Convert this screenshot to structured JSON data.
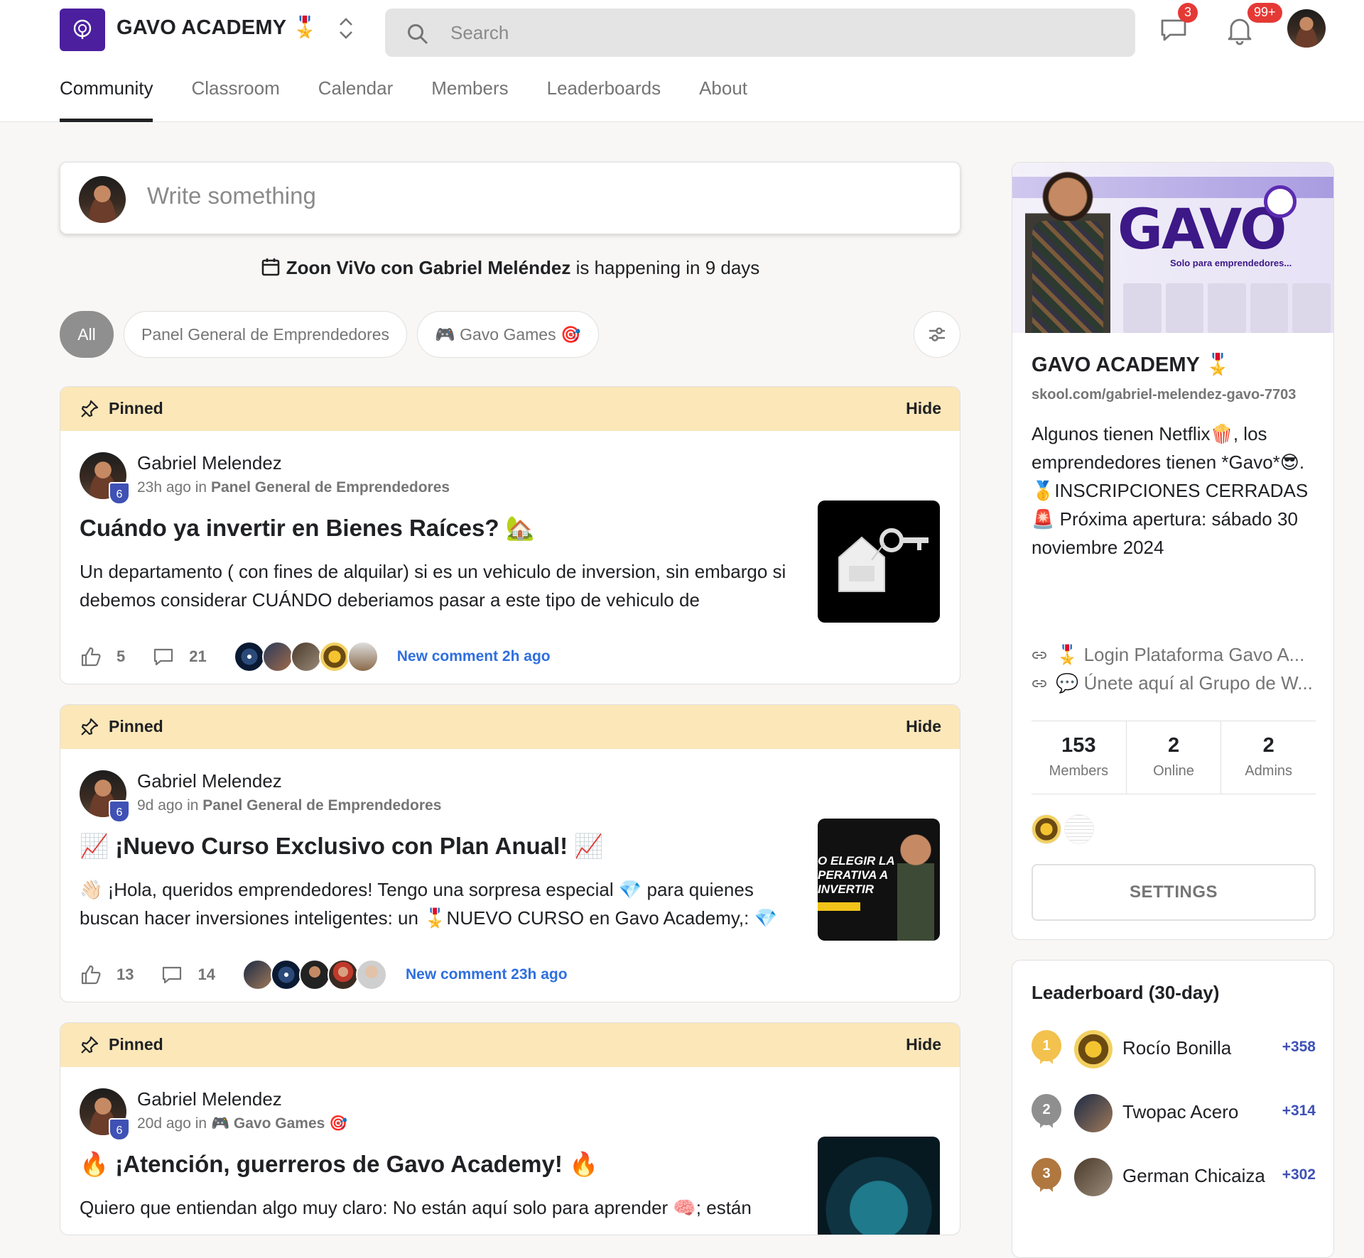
{
  "header": {
    "brand": "GAVO ACADEMY 🎖️",
    "search_placeholder": "Search",
    "chat_badge": "3",
    "notif_badge": "99+",
    "tabs": [
      {
        "label": "Community"
      },
      {
        "label": "Classroom"
      },
      {
        "label": "Calendar"
      },
      {
        "label": "Members"
      },
      {
        "label": "Leaderboards"
      },
      {
        "label": "About"
      }
    ]
  },
  "composer": {
    "placeholder": "Write something"
  },
  "event": {
    "title": "Zoon ViVo con Gabriel Meléndez",
    "suffix": " is happening in 9 days"
  },
  "filters": [
    {
      "label": "All"
    },
    {
      "label": "Panel General de Emprendedores"
    },
    {
      "label": "🎮 Gavo Games 🎯"
    }
  ],
  "posts": [
    {
      "pinned": "Pinned",
      "hide": "Hide",
      "author": "Gabriel Melendez",
      "level": "6",
      "time": "23h ago in ",
      "category": "Panel General de Emprendedores",
      "title": "Cuándo ya invertir en Bienes Raíces? 🏡",
      "body": "Un departamento ( con fines de alquilar) si es un vehiculo de inversion, sin embargo si debemos considerar CUÁNDO deberiamos pasar a este tipo de vehiculo de",
      "likes": "5",
      "comments": "21",
      "new_comment": "New comment 2h ago"
    },
    {
      "pinned": "Pinned",
      "hide": "Hide",
      "author": "Gabriel Melendez",
      "level": "6",
      "time": "9d ago in ",
      "category": "Panel General de Emprendedores",
      "title": "📈 ¡Nuevo Curso Exclusivo con Plan Anual! 📈",
      "body": "👋🏻 ¡Hola, queridos emprendedores! Tengo una sorpresa especial 💎 para quienes buscan hacer inversiones inteligentes: un 🎖️NUEVO CURSO en Gavo Academy,: 💎",
      "likes": "13",
      "comments": "14",
      "new_comment": "New comment 23h ago",
      "thumb_text": "O ELEGIR LA PERATIVA A INVERTIR"
    },
    {
      "pinned": "Pinned",
      "hide": "Hide",
      "author": "Gabriel Melendez",
      "level": "6",
      "time": "20d ago in ",
      "category": "🎮 Gavo Games 🎯",
      "title": "🔥 ¡Atención, guerreros de Gavo Academy! 🔥",
      "body": "Quiero que entiendan algo muy claro: No están aquí solo para aprender 🧠; están"
    }
  ],
  "group": {
    "cover_word": "GAVO",
    "cover_sub": "Solo para emprendedores...",
    "name": "GAVO ACADEMY 🎖️",
    "url": "skool.com/gabriel-melendez-gavo-7703",
    "description": "Algunos tienen Netflix🍿, los emprendedores tienen *Gavo*😎. 🥇INSCRIPCIONES CERRADAS 🚨 Próxima apertura: sábado 30 noviembre 2024",
    "links": [
      {
        "label": "🎖️ Login Plataforma Gavo A..."
      },
      {
        "label": "💬 Únete aquí al Grupo de W..."
      }
    ],
    "stats": [
      {
        "value": "153",
        "label": "Members"
      },
      {
        "value": "2",
        "label": "Online"
      },
      {
        "value": "2",
        "label": "Admins"
      }
    ],
    "settings_label": "SETTINGS"
  },
  "leaderboard": {
    "title": "Leaderboard (30-day)",
    "rows": [
      {
        "rank": "1",
        "name": "Rocío Bonilla",
        "points": "+358",
        "medal_color": "#f2c14e"
      },
      {
        "rank": "2",
        "name": "Twopac Acero",
        "points": "+314",
        "medal_color": "#8f8f8f"
      },
      {
        "rank": "3",
        "name": "German Chicaiza",
        "points": "+302",
        "medal_color": "#b0773f"
      }
    ]
  }
}
